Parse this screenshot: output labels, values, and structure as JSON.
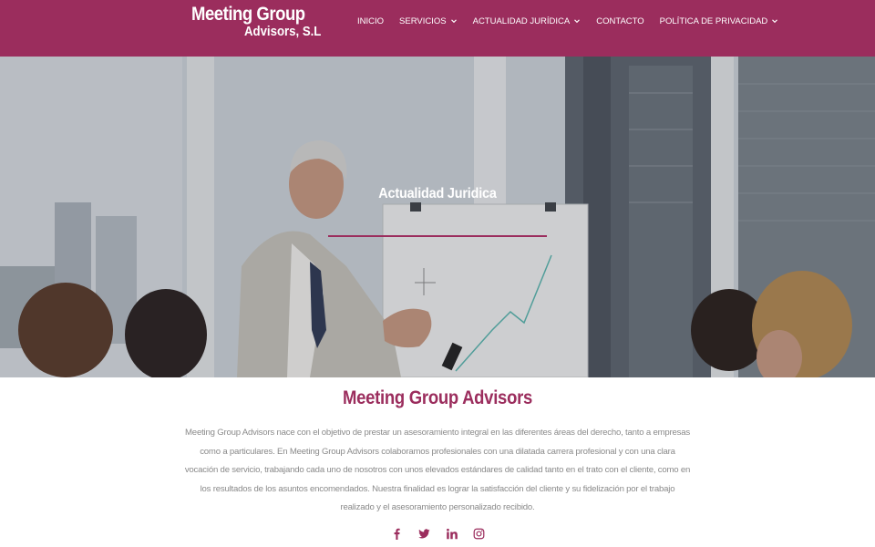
{
  "brand": {
    "line1": "Meeting Group",
    "line2": "Advisors, S.L"
  },
  "nav": {
    "items": [
      {
        "label": "Inicio",
        "has_dropdown": false
      },
      {
        "label": "Servicios",
        "has_dropdown": true
      },
      {
        "label": "Actualidad Jurídica",
        "has_dropdown": true
      },
      {
        "label": "Contacto",
        "has_dropdown": false
      },
      {
        "label": "Política de privacidad",
        "has_dropdown": true
      }
    ]
  },
  "hero": {
    "title": "Actualidad Juridica"
  },
  "about": {
    "title": "Meeting Group Advisors",
    "text": "Meeting Group Advisors nace con el objetivo de prestar un asesoramiento integral en las diferentes áreas del derecho, tanto a empresas como a particulares. En Meeting Group Advisors colaboramos profesionales con una dilatada carrera profesional y con una clara vocación de servicio, trabajando cada uno de nosotros con unos elevados estándares de calidad tanto en el trato con el cliente, como en los resultados de los asuntos encomendados. Nuestra finalidad es lograr la satisfacción del cliente y su fidelización por el trabajo realizado y el asesoramiento personalizado recibido."
  },
  "social": [
    "facebook-icon",
    "twitter-icon",
    "linkedin-icon",
    "instagram-icon"
  ],
  "colors": {
    "brand": "#9b2d5d",
    "text_muted": "#8a8a8a",
    "white": "#ffffff"
  }
}
